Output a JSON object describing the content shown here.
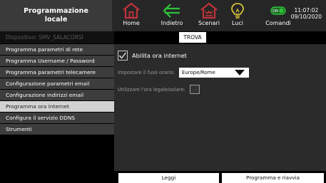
{
  "header": {
    "title_line1": "Programmazione",
    "title_line2": "locale",
    "nav": [
      {
        "label": "Home",
        "icon": "home-icon"
      },
      {
        "label": "Indietro",
        "icon": "back-arrow-icon"
      },
      {
        "label": "Scenari",
        "icon": "scenes-icon"
      },
      {
        "label": "Luci",
        "icon": "lightbulb-icon"
      },
      {
        "label": "Comandi",
        "icon": "toggle-switch-icon",
        "toggle_text": "ON"
      }
    ],
    "time": "11:07:02",
    "date": "09/10/2020",
    "accent_color": "#c0333a",
    "green_color": "#2fc23a",
    "yellow_color": "#e8d23a"
  },
  "device": {
    "label": "Dispositivo: SMV_SALACORSI",
    "find_button": "TROVA"
  },
  "sidebar": {
    "items": [
      {
        "label": "Programma parametri di rete"
      },
      {
        "label": "Programma Username / Password"
      },
      {
        "label": "Programma parametri telecamere"
      },
      {
        "label": "Configurazione parametri email"
      },
      {
        "label": "Configurazione indirizzi email"
      },
      {
        "label": "Programma ora internet",
        "active": true
      },
      {
        "label": "Configura il servizio DDNS"
      },
      {
        "label": "Strumenti"
      }
    ]
  },
  "main": {
    "enable_internet_time": {
      "label": "Abilita ora internet",
      "checked": true
    },
    "timezone": {
      "label": "Impostare il fuso orario:",
      "value": "Europe/Rome"
    },
    "daylight_saving": {
      "label": "Utilizzare l'ora legale/solare:",
      "checked": false
    }
  },
  "footer": {
    "read_button": "Leggi",
    "program_restart_button": "Programma e riavvia"
  }
}
